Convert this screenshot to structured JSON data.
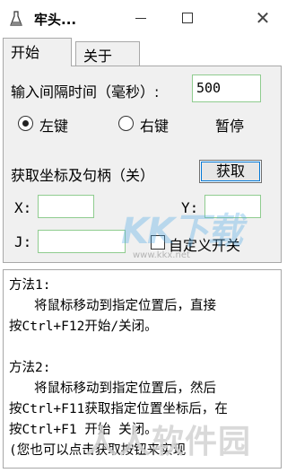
{
  "window": {
    "title": "牢头...",
    "app_icon": "flask-icon",
    "minimize_icon": "minimize-icon",
    "maximize_icon": "maximize-icon",
    "close_glyph": "✕"
  },
  "tabs": [
    {
      "label": "开始",
      "active": true
    },
    {
      "label": "关于",
      "active": false
    }
  ],
  "start_tab": {
    "interval_label": "输入间隔时间（毫秒）:",
    "interval_value": "500",
    "radio_left": {
      "label": "左键",
      "checked": true
    },
    "radio_right": {
      "label": "右键",
      "checked": false
    },
    "pause_label": "暂停",
    "coord_label": "获取坐标及句柄（关）",
    "get_button": "获取",
    "x_label": "X:",
    "x_value": "",
    "y_label": "Y:",
    "y_value": "",
    "j_label": "J:",
    "j_value": "",
    "custom_toggle_label": "自定义开关",
    "custom_toggle_checked": false
  },
  "instructions": {
    "lines": [
      "方法1:",
      "    将鼠标移动到指定位置后，直接",
      "按Ctrl+F12开始/关闭。",
      "",
      "方法2:",
      "    将鼠标移动到指定位置后，然后",
      "按Ctrl+F11获取指定位置坐标后，在",
      "按Ctrl+F1 开始 关闭。",
      "  (您也可以点击获取按钮来实现"
    ]
  },
  "watermarks": {
    "logo": "KK下载",
    "url": "www.kkx.net",
    "big": "人人软件园"
  }
}
